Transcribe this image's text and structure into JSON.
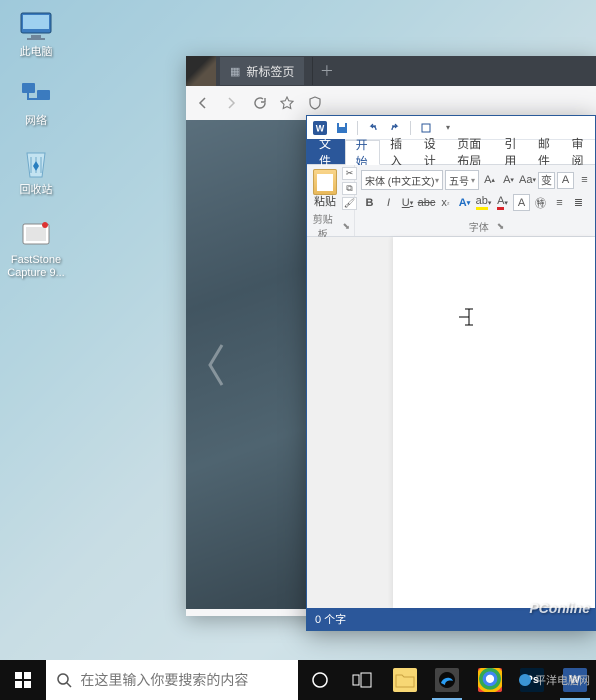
{
  "desktop": {
    "icons": [
      {
        "label": "此电脑"
      },
      {
        "label": "网络"
      },
      {
        "label": "回收站"
      },
      {
        "label": "FastStone\nCapture 9..."
      }
    ]
  },
  "browser": {
    "tab_label": "新标签页"
  },
  "word": {
    "tabs": {
      "file": "文件",
      "home": "开始",
      "insert": "插入",
      "design": "设计",
      "layout": "页面布局",
      "references": "引用",
      "mailings": "邮件",
      "review": "审阅"
    },
    "ribbon": {
      "clipboard": {
        "label": "剪贴板",
        "paste": "粘贴"
      },
      "font": {
        "label": "字体",
        "font_name": "宋体 (中文正文)",
        "font_size": "五号"
      }
    },
    "status": "0 个字"
  },
  "taskbar": {
    "search_placeholder": "在这里输入你要搜索的内容"
  },
  "watermarks": {
    "top": "PConline",
    "bottom": "平洋电脑网"
  }
}
